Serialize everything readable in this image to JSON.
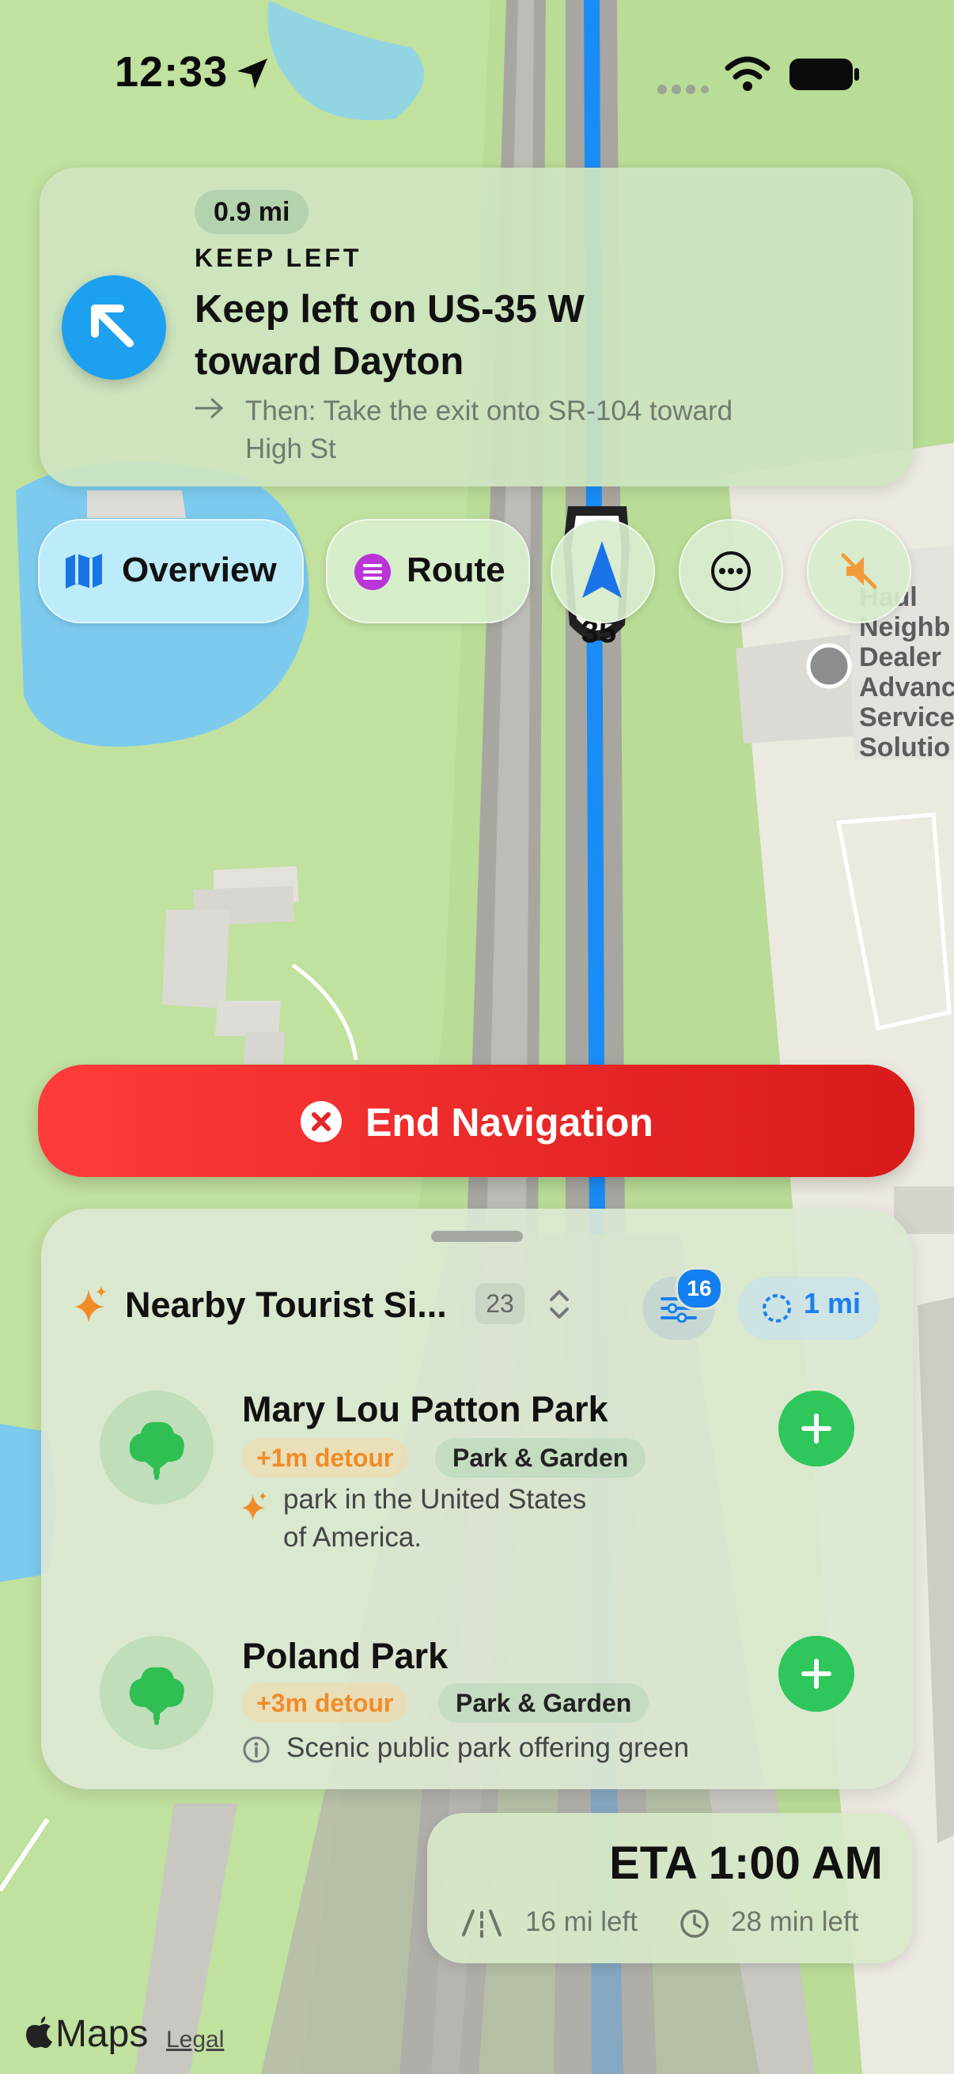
{
  "status_bar": {
    "time": "12:33"
  },
  "banner": {
    "distance": "0.9 mi",
    "maneuver": "KEEP LEFT",
    "instruction_line1": "Keep left on US-35 W",
    "instruction_line2": "toward Dayton",
    "then_line1": "Then: Take the exit onto SR-104 toward",
    "then_line2": "High St"
  },
  "controls": {
    "overview_label": "Overview",
    "route_label": "Route"
  },
  "map_labels": {
    "shield": "35",
    "business_lines": [
      "Haul",
      "Neighb",
      "Dealer",
      "Advanc",
      "Service",
      "Solutio"
    ]
  },
  "end_navigation": {
    "label": "End Navigation"
  },
  "sheet": {
    "title": "Nearby Tourist Si...",
    "count": "23",
    "filter_badge": "16",
    "radius": "1 mi",
    "items": [
      {
        "name": "Mary Lou Patton Park",
        "detour": "+1m detour",
        "category": "Park & Garden",
        "desc_line1": "park in the United States",
        "desc_line2": "of America."
      },
      {
        "name": "Poland Park",
        "detour": "+3m detour",
        "category": "Park & Garden",
        "desc_line1": "Scenic public park offering green"
      }
    ]
  },
  "eta": {
    "title": "ETA 1:00 AM",
    "distance_left": "16 mi left",
    "time_left": "28 min left"
  },
  "footer": {
    "brand": "Maps",
    "legal": "Legal"
  },
  "colors": {
    "accent_blue": "#1ea0f0",
    "end_red": "#e5262a",
    "add_green": "#2fc65b",
    "detour_orange": "#f08c28"
  },
  "icons": [
    "location-arrow-icon",
    "wifi-icon",
    "battery-icon",
    "turn-arrow-icon",
    "map-icon",
    "list-icon",
    "compass-icon",
    "more-icon",
    "mute-icon",
    "close-icon",
    "sparkle-icon",
    "chevron-updown-icon",
    "filter-icon",
    "radius-icon",
    "tree-icon",
    "plus-icon",
    "info-icon",
    "road-icon",
    "clock-icon",
    "apple-icon"
  ]
}
